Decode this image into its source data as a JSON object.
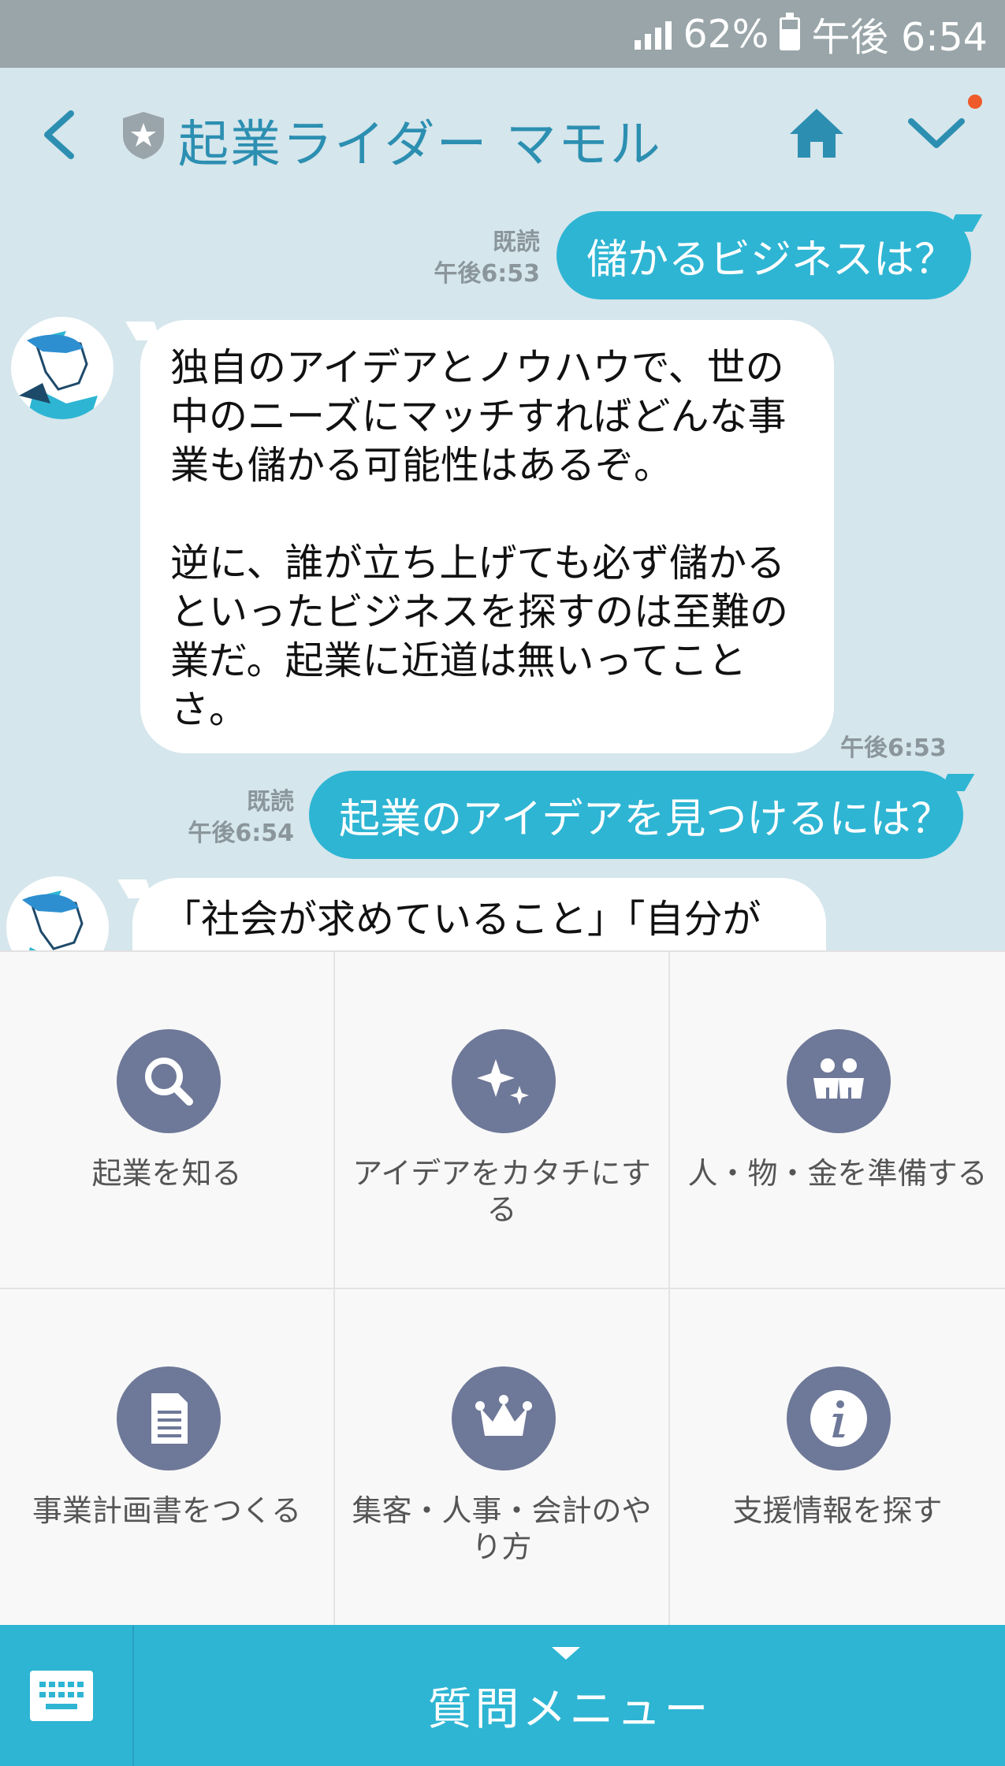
{
  "status_bar": {
    "battery_percent": "62%",
    "time": "午後 6:54"
  },
  "header": {
    "title": "起業ライダー マモル"
  },
  "messages": {
    "out1": {
      "text": "儲かるビジネスは？",
      "read": "既読",
      "time": "午後6:53"
    },
    "in1": {
      "text": "独自のアイデアとノウハウで、世の\n中のニーズにマッチすればどんな事\n業も儲かる可能性はあるぞ。\n\n逆に、誰が立ち上げても必ず儲かる\nといったビジネスを探すのは至難の\n業だ。起業に近道は無いってこと\nさ。",
      "time": "午後6:53"
    },
    "out2": {
      "text": "起業のアイデアを見つけるには？",
      "read": "既読",
      "time": "午後6:54"
    },
    "in2": {
      "text": "「社会が求めていること」「自分が"
    }
  },
  "menu": {
    "items": [
      {
        "label": "起業を知る",
        "icon": "search-icon"
      },
      {
        "label": "アイデアをカタチにする",
        "icon": "sparkle-icon"
      },
      {
        "label": "人・物・金を準備する",
        "icon": "people-icon"
      },
      {
        "label": "事業計画書をつくる",
        "icon": "document-icon"
      },
      {
        "label": "集客・人事・会計のやり方",
        "icon": "crown-icon"
      },
      {
        "label": "支援情報を探す",
        "icon": "info-icon"
      }
    ]
  },
  "bottom_bar": {
    "menu_label": "質問メニュー",
    "keyboard_icon": "keyboard-icon"
  },
  "colors": {
    "accent": "#2eb5d3",
    "chat_bg": "#d5e6ec",
    "header_text": "#2c8fb1",
    "menu_icon_bg": "#6e7898",
    "status_bar": "#99a5a8"
  }
}
